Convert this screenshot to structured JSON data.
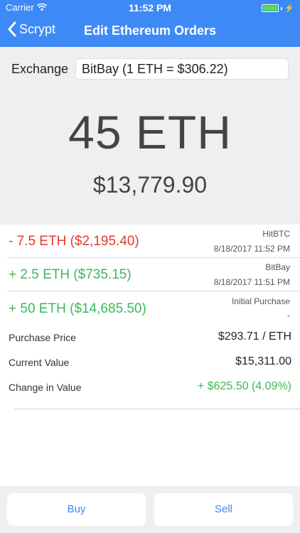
{
  "status_bar": {
    "carrier": "Carrier",
    "time": "11:52 PM"
  },
  "nav": {
    "back_label": "Scrypt",
    "title": "Edit Ethereum Orders"
  },
  "exchange": {
    "label": "Exchange",
    "selected": "BitBay (1 ETH = $306.22)"
  },
  "holdings": {
    "amount": "45 ETH",
    "value": "$13,779.90"
  },
  "orders": [
    {
      "amount": "- 7.5 ETH ($2,195.40)",
      "exchange": "HitBTC",
      "date": "8/18/2017 11:52 PM",
      "type": "sell"
    },
    {
      "amount": "+ 2.5 ETH ($735.15)",
      "exchange": "BitBay",
      "date": "8/18/2017 11:51 PM",
      "type": "buy"
    }
  ],
  "initial": {
    "amount": "+ 50 ETH ($14,685.50)",
    "label": "Initial Purchase",
    "date": "-"
  },
  "summary": {
    "purchase_price_label": "Purchase Price",
    "purchase_price": "$293.71 / ETH",
    "current_value_label": "Current Value",
    "current_value": "$15,311.00",
    "change_label": "Change in Value",
    "change": "+ $625.50 (4.09%)"
  },
  "buttons": {
    "buy": "Buy",
    "sell": "Sell"
  },
  "colors": {
    "accent": "#3d8af7",
    "negative": "#e23b35",
    "positive": "#3cb859"
  }
}
